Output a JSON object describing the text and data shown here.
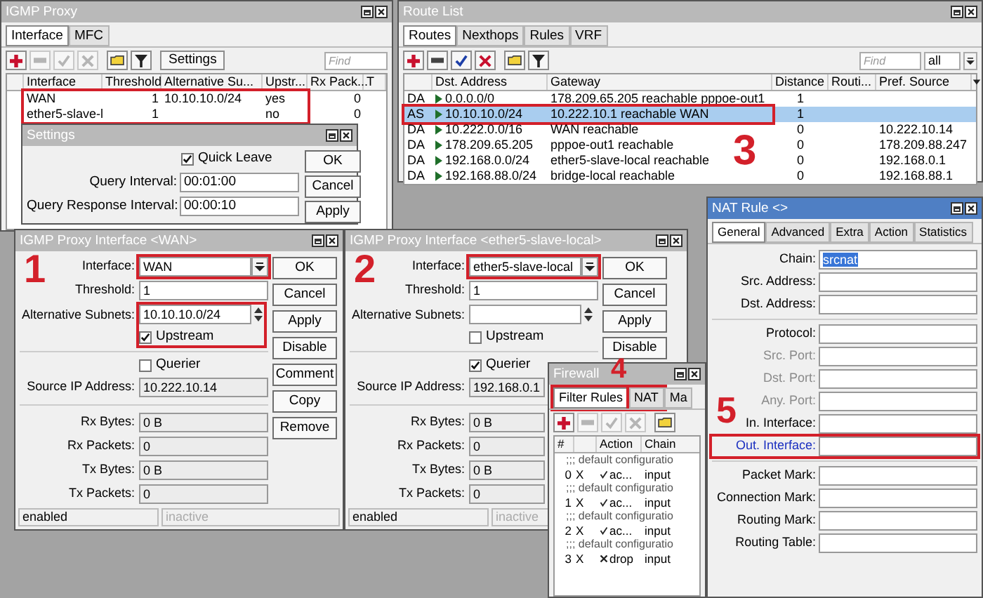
{
  "igmp_proxy": {
    "title": "IGMP Proxy",
    "tabs": [
      {
        "label": "Interface",
        "selected": true
      },
      {
        "label": "MFC",
        "selected": false
      }
    ],
    "toolbar": [
      {
        "kind": "add",
        "disabled": false
      },
      {
        "kind": "remove",
        "disabled": true
      },
      {
        "kind": "enable",
        "disabled": true
      },
      {
        "kind": "disable",
        "disabled": true
      },
      {
        "kind": "comment",
        "disabled": false
      },
      {
        "kind": "filter",
        "disabled": false
      }
    ],
    "settings_button": "Settings",
    "find_placeholder": "Find",
    "columns": [
      "Interface",
      "Threshold",
      "Alternative Su...",
      "Upstr...",
      "Rx Pack...",
      "T"
    ],
    "rows_highlighted": true,
    "rows": [
      {
        "interface": "WAN",
        "threshold": "1",
        "alt_subnets": "10.10.10.0/24",
        "upstream": "yes",
        "rx_packets": "0"
      },
      {
        "interface": "ether5-slave-l",
        "threshold": "1",
        "upstream": "no",
        "rx_packets": "0"
      }
    ]
  },
  "settings": {
    "title": "Settings",
    "quick_leave": {
      "label": "Quick Leave",
      "checked": true
    },
    "fields": [
      {
        "label": "Query Interval:",
        "value": "00:01:00"
      },
      {
        "label": "Query Response Interval:",
        "value": "00:00:10"
      }
    ],
    "buttons": [
      "OK",
      "Cancel",
      "Apply"
    ]
  },
  "route_list": {
    "title": "Route List",
    "callout": "3",
    "tabs": [
      {
        "label": "Routes",
        "selected": true
      },
      {
        "label": "Nexthops",
        "selected": false
      },
      {
        "label": "Rules",
        "selected": false
      },
      {
        "label": "VRF",
        "selected": false
      }
    ],
    "toolbar": [
      {
        "kind": "add",
        "disabled": false
      },
      {
        "kind": "remove",
        "disabled": false
      },
      {
        "kind": "enable",
        "disabled": false
      },
      {
        "kind": "disable",
        "disabled": false
      },
      {
        "kind": "comment",
        "disabled": false
      },
      {
        "kind": "filter",
        "disabled": false
      }
    ],
    "find_placeholder": "Find",
    "filter": "all",
    "columns": [
      "Dst. Address",
      "Gateway",
      "Distance",
      "Routi...",
      "Pref. Source"
    ],
    "rows": [
      {
        "flags": "DA",
        "dst": "0.0.0.0/0",
        "gateway": "178.209.65.205 reachable pppoe-out1",
        "distance": "1",
        "selected": false,
        "highlighted": false
      },
      {
        "flags": "AS",
        "dst": "10.10.10.0/24",
        "gateway": "10.222.10.1 reachable WAN",
        "distance": "1",
        "selected": true,
        "highlighted": true
      },
      {
        "flags": "DA",
        "dst": "10.222.0.0/16",
        "gateway": "WAN reachable",
        "distance": "0",
        "pref_source": "10.222.10.14",
        "selected": false,
        "highlighted": false
      },
      {
        "flags": "DA",
        "dst": "178.209.65.205",
        "gateway": "pppoe-out1 reachable",
        "distance": "0",
        "pref_source": "178.209.88.247",
        "selected": false,
        "highlighted": false
      },
      {
        "flags": "DA",
        "dst": "192.168.0.0/24",
        "gateway": "ether5-slave-local reachable",
        "distance": "0",
        "pref_source": "192.168.0.1",
        "selected": false,
        "highlighted": false
      },
      {
        "flags": "DA",
        "dst": "192.168.88.0/24",
        "gateway": "bridge-local reachable",
        "distance": "0",
        "pref_source": "192.168.88.1",
        "selected": false,
        "highlighted": false
      }
    ]
  },
  "interface_windows": [
    {
      "title": "IGMP Proxy Interface <WAN>",
      "callout": "1",
      "interface": {
        "label": "Interface:",
        "value": "WAN",
        "highlighted": true
      },
      "threshold": {
        "label": "Threshold:",
        "value": "1"
      },
      "alt_subnets": {
        "label": "Alternative Subnets:",
        "value": "10.10.10.0/24",
        "highlighted": true
      },
      "upstream": {
        "label": "Upstream",
        "checked": true
      },
      "querier": {
        "label": "Querier",
        "checked": false
      },
      "source_ip": {
        "label": "Source IP Address:",
        "value": "10.222.10.14"
      },
      "stats": [
        {
          "label": "Rx Bytes:",
          "value": "0 B"
        },
        {
          "label": "Rx Packets:",
          "value": "0"
        },
        {
          "label": "Tx Bytes:",
          "value": "0 B"
        },
        {
          "label": "Tx Packets:",
          "value": "0"
        }
      ],
      "buttons": [
        "OK",
        "Cancel",
        "Apply",
        "Disable",
        "Comment",
        "Copy",
        "Remove"
      ],
      "status": [
        "enabled",
        "inactive"
      ]
    },
    {
      "title": "IGMP Proxy Interface <ether5-slave-local>",
      "callout": "2",
      "interface": {
        "label": "Interface:",
        "value": "ether5-slave-local",
        "highlighted": true
      },
      "threshold": {
        "label": "Threshold:",
        "value": "1"
      },
      "alt_subnets": {
        "label": "Alternative Subnets:",
        "highlighted": false
      },
      "upstream": {
        "label": "Upstream",
        "checked": false
      },
      "querier": {
        "label": "Querier",
        "checked": true
      },
      "source_ip": {
        "label": "Source IP Address:",
        "value": "192.168.0.1"
      },
      "stats": [
        {
          "label": "Rx Bytes:",
          "value": "0 B"
        },
        {
          "label": "Rx Packets:",
          "value": "0"
        },
        {
          "label": "Tx Bytes:",
          "value": "0 B"
        },
        {
          "label": "Tx Packets:",
          "value": "0"
        }
      ],
      "buttons": [
        "OK",
        "Cancel",
        "Apply",
        "Disable"
      ],
      "status": [
        "enabled",
        "inactive"
      ]
    }
  ],
  "firewall": {
    "title": "Firewall",
    "callout": "4",
    "tabs": [
      {
        "label": "Filter Rules",
        "selected": true,
        "highlighted": true
      },
      {
        "label": "NAT",
        "selected": false,
        "highlighted": true
      },
      {
        "label": "Ma",
        "selected": false,
        "highlighted": false
      }
    ],
    "toolbar": [
      {
        "kind": "add",
        "disabled": false
      },
      {
        "kind": "remove",
        "disabled": true
      },
      {
        "kind": "enable",
        "disabled": true
      },
      {
        "kind": "disable",
        "disabled": true
      },
      {
        "kind": "comment",
        "disabled": false
      }
    ],
    "columns": [
      "#",
      "Action",
      "Chain"
    ],
    "rows": [
      {
        "comment": ";;; default configuratio",
        "number": "0",
        "flag": "X",
        "action": "ac...",
        "kind": "accept",
        "chain": "input"
      },
      {
        "comment": ";;; default configuratio",
        "number": "1",
        "flag": "X",
        "action": "ac...",
        "kind": "accept",
        "chain": "input"
      },
      {
        "comment": ";;; default configuratio",
        "number": "2",
        "flag": "X",
        "action": "ac...",
        "kind": "accept",
        "chain": "input"
      },
      {
        "comment": ";;; default configuratio",
        "number": "3",
        "flag": "X",
        "action": "drop",
        "kind": "drop",
        "chain": "input"
      }
    ]
  },
  "nat_rule": {
    "title": "NAT Rule <>",
    "callout": "5",
    "tabs": [
      {
        "label": "General",
        "selected": true
      },
      {
        "label": "Advanced",
        "selected": false
      },
      {
        "label": "Extra",
        "selected": false
      },
      {
        "label": "Action",
        "selected": false
      },
      {
        "label": "Statistics",
        "selected": false
      }
    ],
    "sections": [
      [
        {
          "label": "Chain:",
          "value": "srcnat",
          "value_selected": true,
          "disabled": false,
          "highlighted": false
        },
        {
          "label": "Src. Address:",
          "disabled": false,
          "highlighted": false
        },
        {
          "label": "Dst. Address:",
          "disabled": false,
          "highlighted": false
        }
      ],
      [
        {
          "label": "Protocol:",
          "disabled": false,
          "highlighted": false
        },
        {
          "label": "Src. Port:",
          "disabled": true,
          "highlighted": false
        },
        {
          "label": "Dst. Port:",
          "disabled": true,
          "highlighted": false
        },
        {
          "label": "Any. Port:",
          "disabled": true,
          "highlighted": false
        },
        {
          "label": "In. Interface:",
          "disabled": false,
          "highlighted": false
        },
        {
          "label": "Out. Interface:",
          "disabled": false,
          "highlighted": true
        }
      ],
      [
        {
          "label": "Packet Mark:",
          "disabled": false,
          "highlighted": false
        },
        {
          "label": "Connection Mark:",
          "disabled": false,
          "highlighted": false
        },
        {
          "label": "Routing Mark:",
          "disabled": false,
          "highlighted": false
        },
        {
          "label": "Routing Table:",
          "disabled": false,
          "highlighted": false
        }
      ]
    ]
  }
}
